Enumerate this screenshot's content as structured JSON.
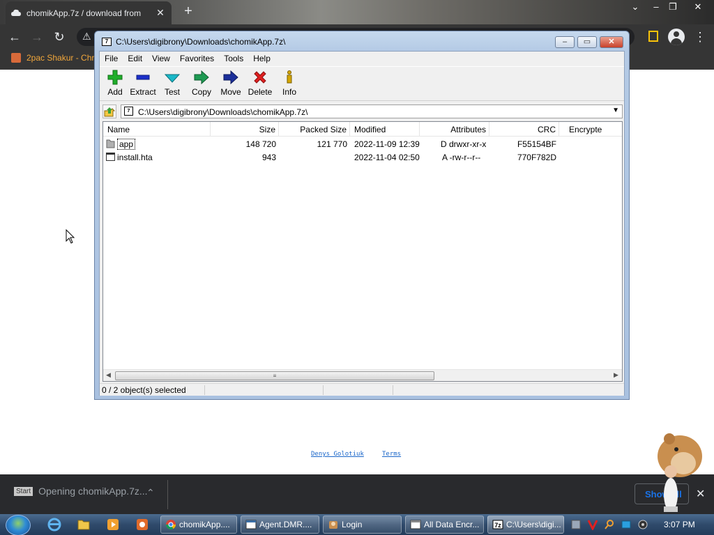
{
  "browser": {
    "tab_title": "chomikApp.7z / download from",
    "new_tab_symbol": "+",
    "bookmark": "2pac Shakur - Chro",
    "footer_links": [
      "Denys Golotiuk",
      "Terms"
    ],
    "download_bar": {
      "item_label": "Opening chomikApp.7z...",
      "start_badge": "Start",
      "show_all": "Show all"
    }
  },
  "sevenzip": {
    "title": "C:\\Users\\digibrony\\Downloads\\chomikApp.7z\\",
    "menu": [
      "File",
      "Edit",
      "View",
      "Favorites",
      "Tools",
      "Help"
    ],
    "toolbar": [
      {
        "label": "Add",
        "icon": "plus-icon",
        "color": "#1fae2a"
      },
      {
        "label": "Extract",
        "icon": "minus-icon",
        "color": "#1b2fc9"
      },
      {
        "label": "Test",
        "icon": "check-icon",
        "color": "#1ab8c8"
      },
      {
        "label": "Copy",
        "icon": "arrow-right-icon",
        "color": "#1d9a52"
      },
      {
        "label": "Move",
        "icon": "arrow-right-icon",
        "color": "#1b2f9a"
      },
      {
        "label": "Delete",
        "icon": "x-icon",
        "color": "#e02020"
      },
      {
        "label": "Info",
        "icon": "info-icon",
        "color": "#d4a600"
      }
    ],
    "address": "C:\\Users\\digibrony\\Downloads\\chomikApp.7z\\",
    "columns": [
      "Name",
      "Size",
      "Packed Size",
      "Modified",
      "Attributes",
      "CRC",
      "Encrypte"
    ],
    "rows": [
      {
        "name": "app",
        "size": "148 720",
        "packed": "121 770",
        "modified": "2022-11-09 12:39",
        "attributes": "D drwxr-xr-x",
        "crc": "F55154BF",
        "type": "folder"
      },
      {
        "name": "install.hta",
        "size": "943",
        "packed": "",
        "modified": "2022-11-04 02:50",
        "attributes": "A -rw-r--r--",
        "crc": "770F782D",
        "type": "file"
      }
    ],
    "status": "0 / 2 object(s) selected"
  },
  "taskbar": {
    "buttons": [
      "chomikApp....",
      "Agent.DMR....",
      "Login",
      "All Data Encr...",
      "C:\\Users\\digi..."
    ],
    "active_index": 4,
    "clock": "3:07 PM"
  }
}
